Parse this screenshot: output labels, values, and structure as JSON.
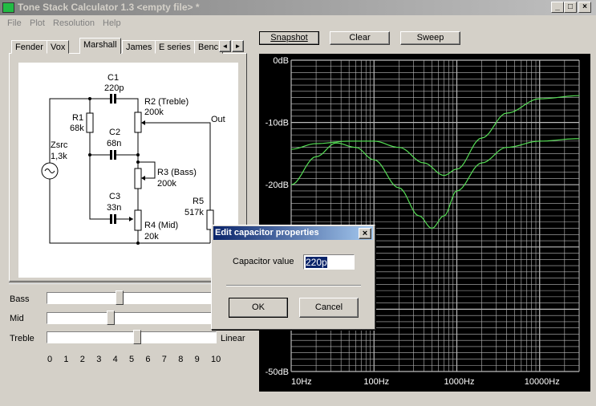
{
  "window": {
    "title": "Tone Stack Calculator 1.3 <empty file> *",
    "controls": [
      "_",
      "□",
      "×"
    ]
  },
  "menu": [
    "File",
    "Plot",
    "Resolution",
    "Help"
  ],
  "tabs": [
    {
      "label": "Fender"
    },
    {
      "label": "Vox"
    },
    {
      "label": "Marshall",
      "active": true
    },
    {
      "label": "James"
    },
    {
      "label": "E series"
    },
    {
      "label": "Benc"
    }
  ],
  "tab_scroll": [
    "◄",
    "►"
  ],
  "schematic": {
    "c1": "C1",
    "c1v": "220p",
    "r2": "R2 (Treble)",
    "r2v": "200k",
    "r1": "R1",
    "r1v": "68k",
    "c2": "C2",
    "c2v": "68n",
    "out": "Out",
    "zsrc": "Zsrc",
    "zsrcv": "1,3k",
    "r3": "R3 (Bass)",
    "r3v": "200k",
    "c3": "C3",
    "c3v": "33n",
    "r5": "R5",
    "r5v": "517k",
    "r4": "R4 (Mid)",
    "r4v": "20k"
  },
  "sliders": [
    {
      "label": "Bass",
      "value": 4.2
    },
    {
      "label": "Mid",
      "value": 3.7
    },
    {
      "label": "Treble",
      "value": 5.3
    }
  ],
  "taper": "Linear",
  "scale": [
    "0",
    "1",
    "2",
    "3",
    "4",
    "5",
    "6",
    "7",
    "8",
    "9",
    "10"
  ],
  "buttons": {
    "snapshot": "Snapshot",
    "clear": "Clear",
    "sweep": "Sweep"
  },
  "dialog": {
    "title": "Edit capacitor properties",
    "close": "×",
    "label": "Capacitor value",
    "value": "220p",
    "ok": "OK",
    "cancel": "Cancel"
  },
  "chart_data": {
    "type": "line",
    "xscale": "log",
    "xlim": [
      10,
      30000
    ],
    "ylim": [
      -50,
      0
    ],
    "grid": true,
    "yticks": [
      "0dB",
      "-10dB",
      "-20dB",
      "-50dB"
    ],
    "xticks": [
      "10Hz",
      "100Hz",
      "1000Hz",
      "10000Hz"
    ],
    "colors": {
      "background": "#000000",
      "grid": "#ffffff",
      "curve": "#55dd55"
    },
    "series": [
      {
        "x": [
          10,
          20,
          50,
          100,
          200,
          400,
          700,
          1000,
          2000,
          4000,
          10000,
          30000
        ],
        "y": [
          -14.3,
          -13.4,
          -13,
          -13,
          -14,
          -16.5,
          -18.5,
          -17.5,
          -12.5,
          -8.5,
          -6.2,
          -5.7
        ]
      },
      {
        "x": [
          10,
          20,
          35,
          60,
          100,
          200,
          350,
          500,
          700,
          1000,
          2000,
          4000,
          10000,
          30000
        ],
        "y": [
          -20,
          -15.5,
          -13.3,
          -14,
          -16,
          -20.5,
          -25,
          -27,
          -25,
          -21,
          -16.5,
          -14,
          -13,
          -12.6
        ]
      }
    ]
  }
}
